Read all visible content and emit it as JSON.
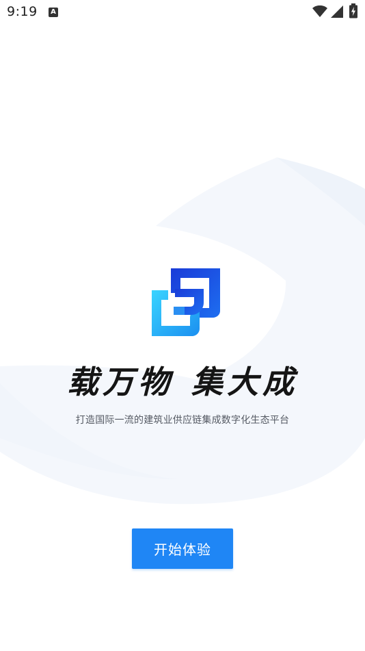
{
  "status_bar": {
    "time": "9:19",
    "notification_icon_letter": "A",
    "icons": [
      "wifi-icon",
      "cell-signal-icon",
      "battery-charging-icon"
    ]
  },
  "brand": {
    "logo_icon": "company-logo-icon",
    "logo_colors": [
      "#1f3ad6",
      "#1fa4f2",
      "#33d0ff"
    ]
  },
  "slogan": {
    "part1": "载万物",
    "part2": "集大成"
  },
  "subtitle": "打造国际一流的建筑业供应链集成数字化生态平台",
  "actions": {
    "start_label": "开始体验"
  },
  "theme": {
    "accent": "#1f86f5",
    "background": "#ffffff",
    "decoration": "#f3f6fb"
  }
}
